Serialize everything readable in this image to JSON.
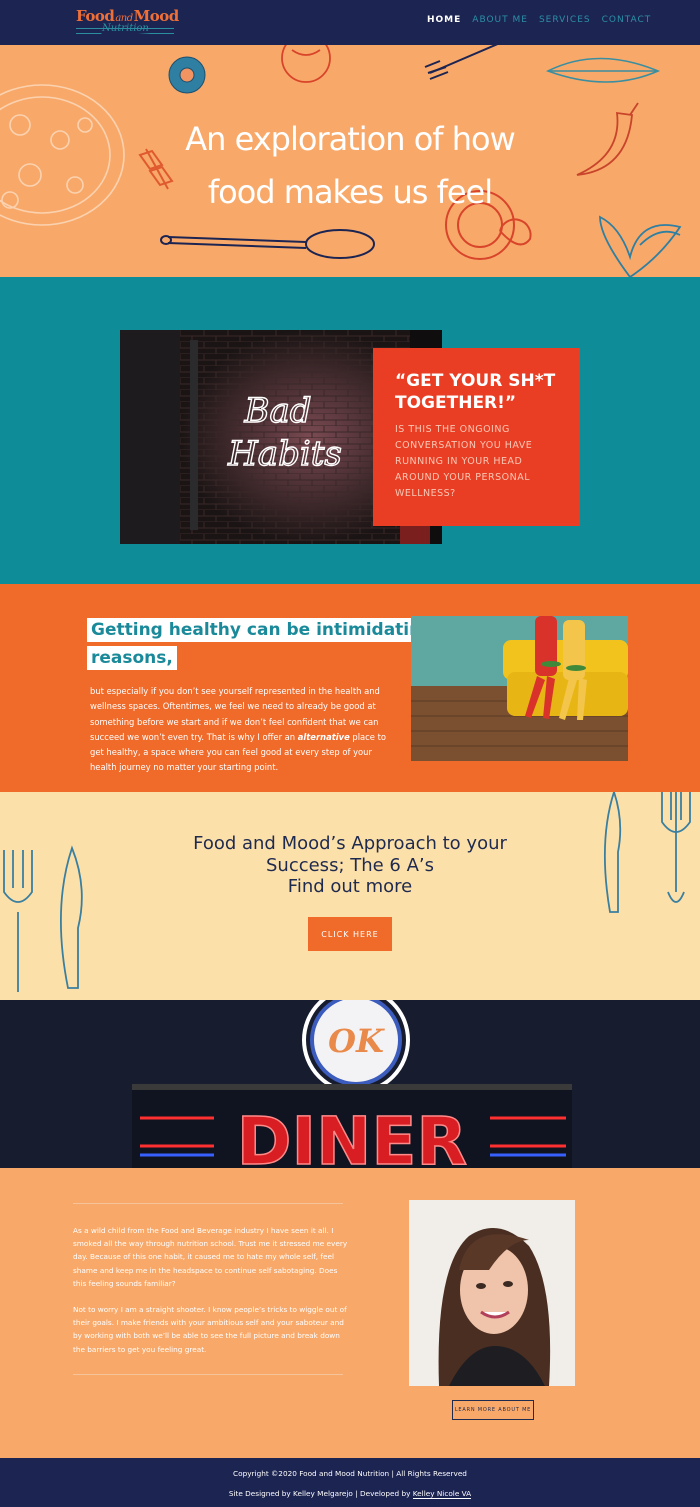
{
  "nav": {
    "logo_food": "Food",
    "logo_and": "and",
    "logo_mood": "Mood",
    "logo_nutrition": "Nutrition",
    "links": [
      "HOME",
      "ABOUT ME",
      "SERVICES",
      "CONTACT"
    ],
    "active": "HOME"
  },
  "hero": {
    "title_line1": "An exploration of how",
    "title_line2": "food makes us feel"
  },
  "callout": {
    "title": "“GET YOUR SH*T TOGETHER!”",
    "text": "IS THIS THE ONGOING CONVERSATION YOU HAVE RUNNING IN YOUR HEAD AROUND YOUR PERSONAL WELLNESS?",
    "neon_line1": "Bad",
    "neon_line2": "Habits"
  },
  "intimidating": {
    "line1": "Getting healthy can be intimidating for many",
    "line2": "reasons,",
    "body_before": "but especially if you don’t see yourself represented in the health and wellness spaces. Oftentimes, we feel we need to already be good at something before we start and if we don’t feel confident that we can succeed we won’t even try. That is why I offer an ",
    "body_em": "alternative",
    "body_after": " place to get healthy, a space where you can feel good at every step of your health journey no matter your starting point."
  },
  "approach": {
    "line1": "Food and Mood’s Approach to your",
    "line2": "Success; The 6 A’s",
    "line3": "Find out more",
    "button": "CLICK HERE"
  },
  "diner": {
    "sign_top": "OK",
    "sign_main": "DINER"
  },
  "about": {
    "p1": "As a wild child from the Food and Beverage industry I have seen it all. I smoked all the way through nutrition school. Trust me it stressed me every day. Because of this one habit, it caused me to hate my whole self, feel shame and keep me in the headspace to continue self sabotaging. Does this feeling sounds familiar?",
    "p2": "Not to worry I am a straight shooter. I know people’s tricks to wiggle out of their goals. I make friends with your ambitious self and your saboteur and by working with both we’ll be able to see the full picture and break down the barriers to get you feeling great.",
    "button": "LEARN MORE ABOUT ME"
  },
  "footer": {
    "copyright": "Copyright ©2020 Food and Mood Nutrition | All Rights Reserved",
    "designed_prefix": "Site Designed by Kelley Melgarejo | Developed by ",
    "developer_link": "Kelley Nicole VA"
  },
  "colors": {
    "navy": "#1c2452",
    "peach": "#f8a96a",
    "teal": "#0e8c97",
    "red": "#ea3e24",
    "orange": "#f06a2a",
    "cream": "#fce0aa"
  }
}
